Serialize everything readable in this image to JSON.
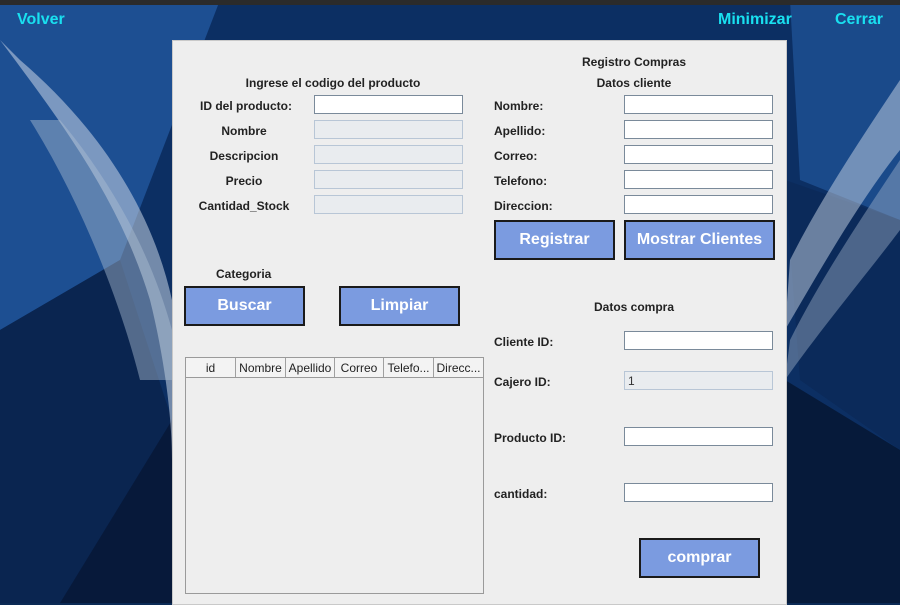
{
  "window": {
    "back_label": "Volver",
    "minimize_label": "Minimizar",
    "close_label": "Cerrar"
  },
  "panel": {
    "title": "Registro Compras",
    "product_section": {
      "heading": "Ingrese el codigo del producto",
      "id_label": "ID del producto:",
      "name_label": "Nombre",
      "description_label": "Descripcion",
      "price_label": "Precio",
      "stock_label": "Cantidad_Stock",
      "id_value": "",
      "name_value": "",
      "description_value": "",
      "price_value": "",
      "stock_value": ""
    },
    "category_label": "Categoria",
    "search_button": "Buscar",
    "clear_button": "Limpiar",
    "client_section": {
      "heading": "Datos cliente",
      "first_name_label": "Nombre:",
      "last_name_label": "Apellido:",
      "email_label": "Correo:",
      "phone_label": "Telefono:",
      "address_label": "Direccion:",
      "first_name_value": "",
      "last_name_value": "",
      "email_value": "",
      "phone_value": "",
      "address_value": "",
      "register_button": "Registrar",
      "show_clients_button": "Mostrar Clientes"
    },
    "purchase_section": {
      "heading": "Datos compra",
      "client_id_label": "Cliente ID:",
      "cashier_id_label": "Cajero ID:",
      "product_id_label": "Producto ID:",
      "quantity_label": "cantidad:",
      "client_id_value": "",
      "cashier_id_value": "1",
      "product_id_value": "",
      "quantity_value": "",
      "buy_button": "comprar"
    },
    "table": {
      "columns": [
        "id",
        "Nombre",
        "Apellido",
        "Correo",
        "Telefo...",
        "Direcc..."
      ],
      "rows": []
    }
  },
  "colors": {
    "button_fill": "#7b9be0",
    "nav_text": "#19e0f0",
    "panel_bg": "#eeeeee"
  }
}
